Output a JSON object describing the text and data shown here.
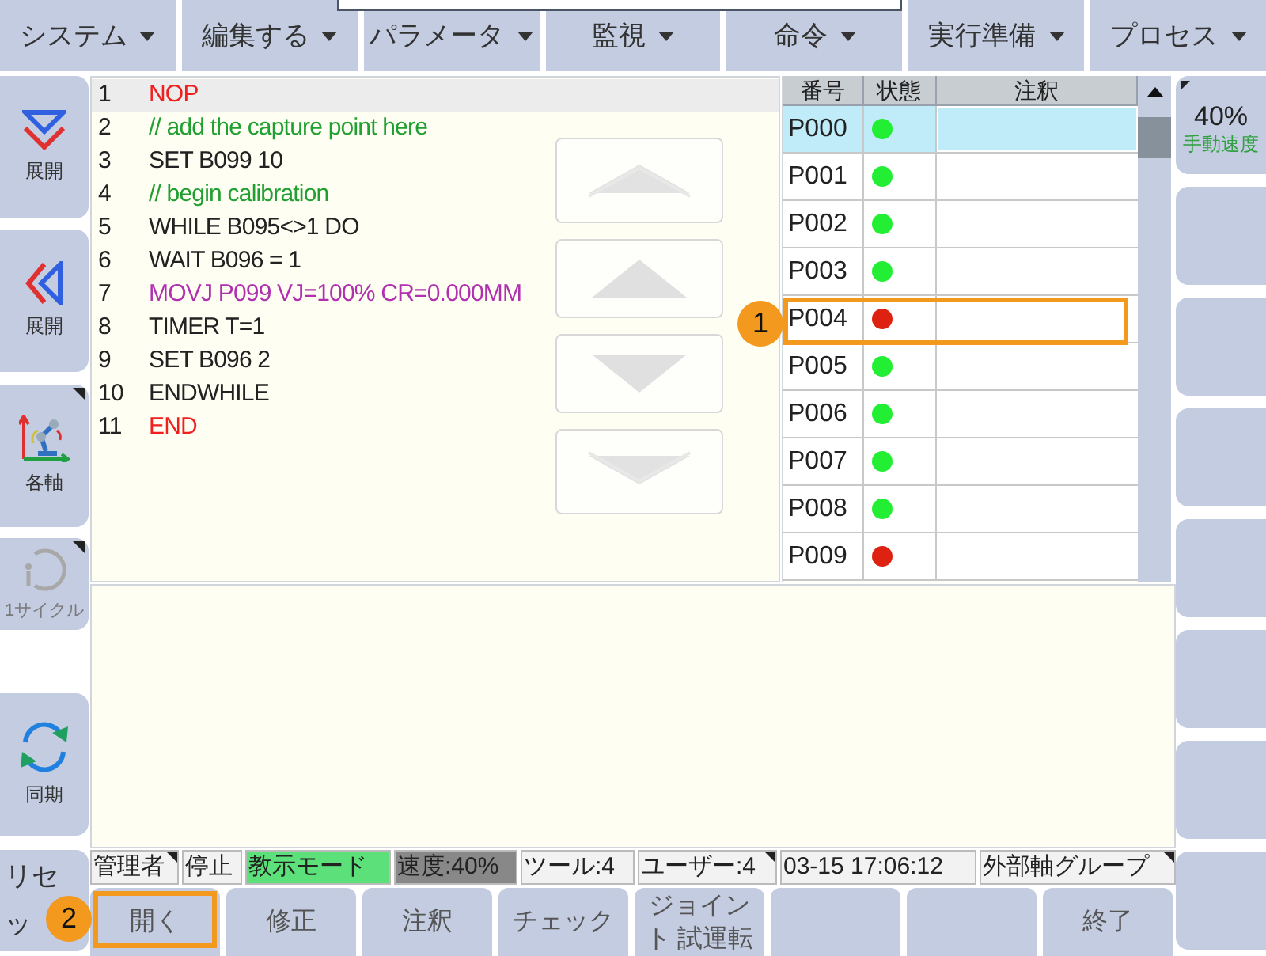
{
  "menu": [
    {
      "label": "システム"
    },
    {
      "label": "編集する"
    },
    {
      "label": "パラメータ"
    },
    {
      "label": "監視"
    },
    {
      "label": "命令"
    },
    {
      "label": "実行準備"
    },
    {
      "label": "プロセス"
    }
  ],
  "left_buttons": [
    {
      "label": "展開",
      "disabled": false,
      "submenu": false
    },
    {
      "label": "展開",
      "disabled": false,
      "submenu": false
    },
    {
      "label": "各軸",
      "disabled": false,
      "submenu": true
    },
    {
      "label": "1サイクル",
      "disabled": true,
      "submenu": true
    },
    {
      "label": "同期",
      "disabled": false,
      "submenu": false
    },
    {
      "label": "リセッ",
      "disabled": false,
      "submenu": false
    }
  ],
  "program": [
    {
      "number": "1",
      "code": "NOP",
      "kind": "keyword",
      "selected": true
    },
    {
      "number": "2",
      "code": "// add the capture point here",
      "kind": "comment",
      "selected": false
    },
    {
      "number": "3",
      "code": "SET B099 10",
      "kind": "plain",
      "selected": false
    },
    {
      "number": "4",
      "code": "// begin calibration",
      "kind": "comment",
      "selected": false
    },
    {
      "number": "5",
      "code": "WHILE B095<>1 DO",
      "kind": "plain",
      "selected": false
    },
    {
      "number": "6",
      "code": "WAIT B096 = 1",
      "kind": "plain",
      "selected": false
    },
    {
      "number": "7",
      "code": "MOVJ P099 VJ=100% CR=0.000MM",
      "kind": "motion",
      "selected": false
    },
    {
      "number": "8",
      "code": "TIMER T=1",
      "kind": "plain",
      "selected": false
    },
    {
      "number": "9",
      "code": "SET B096 2",
      "kind": "plain",
      "selected": false
    },
    {
      "number": "10",
      "code": "ENDWHILE",
      "kind": "plain",
      "selected": false
    },
    {
      "number": "11",
      "code": "END",
      "kind": "keyword",
      "selected": false
    }
  ],
  "points_table": {
    "columns": [
      "番号",
      "状態",
      "注釈"
    ],
    "rows": [
      {
        "name": "P000",
        "color": "#22ee33",
        "selected": true
      },
      {
        "name": "P001",
        "color": "#22ee33",
        "selected": false
      },
      {
        "name": "P002",
        "color": "#22ee33",
        "selected": false
      },
      {
        "name": "P003",
        "color": "#22ee33",
        "selected": false
      },
      {
        "name": "P004",
        "color": "#dd2211",
        "selected": false
      },
      {
        "name": "P005",
        "color": "#22ee33",
        "selected": false
      },
      {
        "name": "P006",
        "color": "#22ee33",
        "selected": false
      },
      {
        "name": "P007",
        "color": "#22ee33",
        "selected": false
      },
      {
        "name": "P008",
        "color": "#22ee33",
        "selected": false
      },
      {
        "name": "P009",
        "color": "#dd2211",
        "selected": false
      }
    ]
  },
  "speed_button": {
    "value": "40%",
    "label": "手動速度"
  },
  "status_bar": [
    {
      "text": "管理者",
      "kind": "menu"
    },
    {
      "text": "停止",
      "kind": "plain"
    },
    {
      "text": "教示モード",
      "kind": "mode"
    },
    {
      "text": "速度:40%",
      "kind": "speed"
    },
    {
      "text": "ツール:4",
      "kind": "plain"
    },
    {
      "text": "ユーザー:4",
      "kind": "menu"
    },
    {
      "text": "03-15 17:06:12",
      "kind": "plain"
    },
    {
      "text": "外部軸グループ",
      "kind": "menu"
    }
  ],
  "bottom_buttons": [
    {
      "label": "開く"
    },
    {
      "label": "修正"
    },
    {
      "label": "注釈"
    },
    {
      "label": "チェック"
    },
    {
      "label": "ジョイント 試運転"
    }
  ],
  "exit_button": {
    "label": "終了"
  },
  "callouts": [
    {
      "number": "1"
    },
    {
      "number": "2"
    }
  ]
}
